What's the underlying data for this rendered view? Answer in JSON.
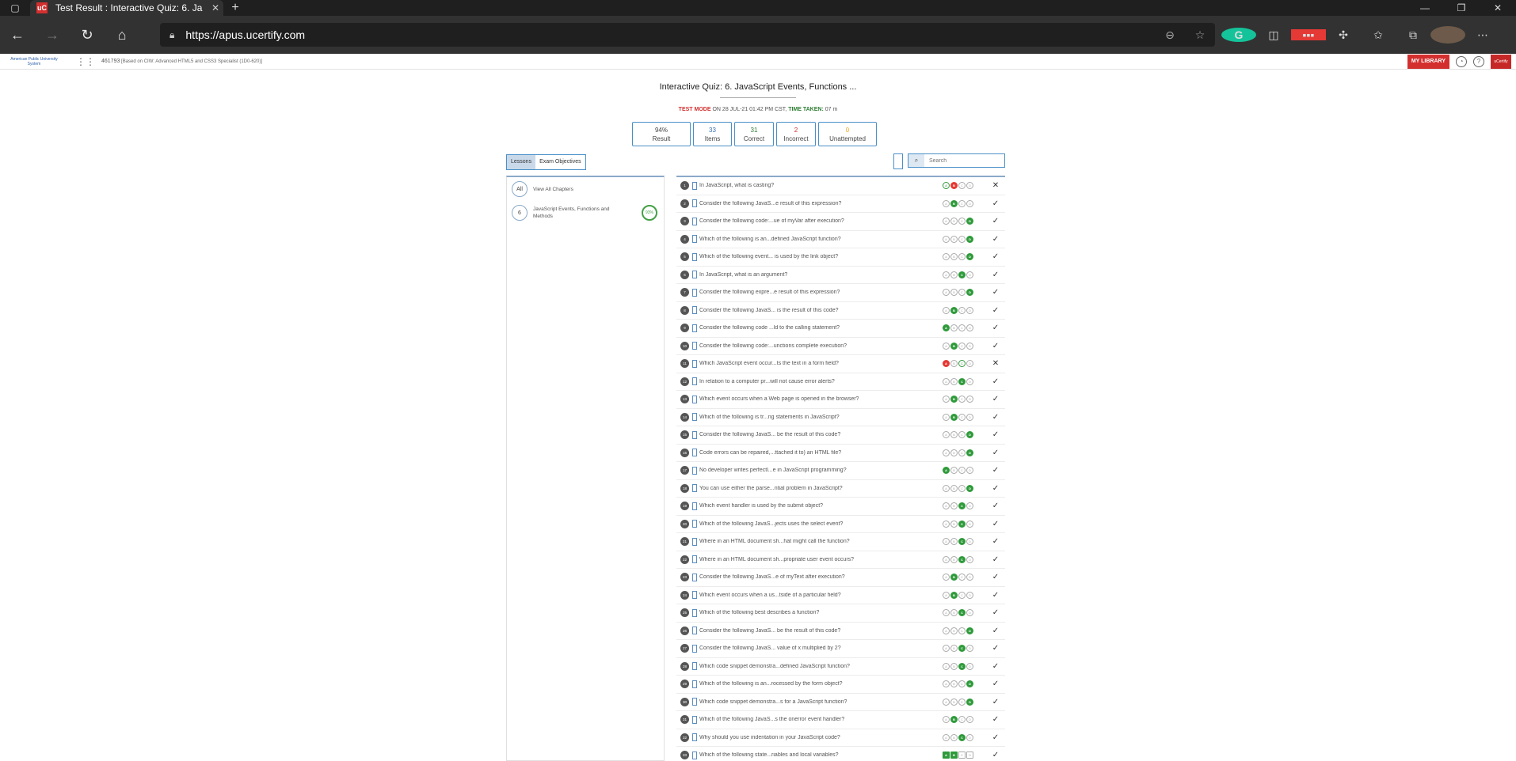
{
  "browser": {
    "tab_title": "Test Result : Interactive Quiz: 6. Ja",
    "url": "https://apus.ucertify.com",
    "new_tab": "+",
    "favicon_text": "uC"
  },
  "header": {
    "logo_text": "American Public University System",
    "course_id": "461793",
    "course_desc": "[Based on CIW: Advanced HTML5 and CSS3 Specialist (1D0-620)]",
    "my_library": "MY LIBRARY",
    "brand": "uCertify"
  },
  "quiz": {
    "title": "Interactive Quiz: 6. JavaScript Events, Functions ...",
    "mode_label": "TEST MODE",
    "on_label": "ON",
    "date": "28 JUL-21 01:42 PM CST,",
    "time_label": "TIME TAKEN:",
    "time_value": "07 m"
  },
  "stats": [
    {
      "value": "94%",
      "label": "Result",
      "color": "#333333"
    },
    {
      "value": "33",
      "label": "Items",
      "color": "#3a6fb0"
    },
    {
      "value": "31",
      "label": "Correct",
      "color": "#2e7d32"
    },
    {
      "value": "2",
      "label": "Incorrect",
      "color": "#d32f2f"
    },
    {
      "value": "0",
      "label": "Unattempted",
      "color": "#f5a623"
    }
  ],
  "tabs": {
    "lessons": "Lessons",
    "objectives": "Exam Objectives"
  },
  "search": {
    "placeholder": "Search"
  },
  "left_panel": {
    "all_label": "All",
    "all_text": "View All Chapters",
    "chapter_num": "6",
    "chapter_text": "JavaScript Events, Functions and Methods",
    "chapter_progress": "93%"
  },
  "questions": [
    {
      "n": "1",
      "text": "In JavaScript, what is casting?",
      "opts": [
        "g",
        "w",
        "",
        ""
      ],
      "mark": "✕"
    },
    {
      "n": "2",
      "text": "Consider the following JavaS...e result of this expression?",
      "opts": [
        "",
        "c",
        "",
        ""
      ],
      "mark": "✓"
    },
    {
      "n": "3",
      "text": "Consider the following code:...ue of myVar after execution?",
      "opts": [
        "",
        "",
        "",
        "c"
      ],
      "mark": "✓"
    },
    {
      "n": "4",
      "text": "Which of the following is an...defined JavaScript function?",
      "opts": [
        "",
        "",
        "",
        "c"
      ],
      "mark": "✓"
    },
    {
      "n": "5",
      "text": "Which of the following event... is used by the link object?",
      "opts": [
        "",
        "",
        "",
        "c"
      ],
      "mark": "✓"
    },
    {
      "n": "6",
      "text": "In JavaScript, what is an argument?",
      "opts": [
        "",
        "",
        "c",
        ""
      ],
      "mark": "✓"
    },
    {
      "n": "7",
      "text": "Consider the following expre...e result of this expression?",
      "opts": [
        "",
        "",
        "",
        "c"
      ],
      "mark": "✓"
    },
    {
      "n": "8",
      "text": "Consider the following JavaS... is the result of this code?",
      "opts": [
        "",
        "c",
        "",
        ""
      ],
      "mark": "✓"
    },
    {
      "n": "9",
      "text": "Consider the following code ...ld to the calling statement?",
      "opts": [
        "c",
        "",
        "",
        ""
      ],
      "mark": "✓"
    },
    {
      "n": "10",
      "text": "Consider the following code:...unctions complete execution?",
      "opts": [
        "",
        "c",
        "",
        ""
      ],
      "mark": "✓"
    },
    {
      "n": "11",
      "text": "Which JavaScript event occur...ts the text in a form field?",
      "opts": [
        "w",
        "",
        "g",
        ""
      ],
      "mark": "✕"
    },
    {
      "n": "12",
      "text": "In relation to a computer pr...will not cause error alerts?",
      "opts": [
        "",
        "",
        "c",
        ""
      ],
      "mark": "✓"
    },
    {
      "n": "13",
      "text": "Which event occurs when a Web page is opened in the browser?",
      "opts": [
        "",
        "c",
        "",
        ""
      ],
      "mark": "✓"
    },
    {
      "n": "14",
      "text": "Which of the following is tr...ng statements in JavaScript?",
      "opts": [
        "",
        "c",
        "",
        ""
      ],
      "mark": "✓"
    },
    {
      "n": "15",
      "text": "Consider the following JavaS... be the result of this code?",
      "opts": [
        "",
        "",
        "",
        "c"
      ],
      "mark": "✓"
    },
    {
      "n": "16",
      "text": "Code errors can be repaired,...ttached it to) an HTML file?",
      "opts": [
        "",
        "",
        "",
        "c"
      ],
      "mark": "✓"
    },
    {
      "n": "17",
      "text": "No developer writes perfectl...e in JavaScript programming?",
      "opts": [
        "c",
        "",
        "",
        ""
      ],
      "mark": "✓"
    },
    {
      "n": "18",
      "text": "You can use either the parse...ntial problem in JavaScript?",
      "opts": [
        "",
        "",
        "",
        "c"
      ],
      "mark": "✓"
    },
    {
      "n": "19",
      "text": "Which event handler is used by the submit object?",
      "opts": [
        "",
        "",
        "c",
        ""
      ],
      "mark": "✓"
    },
    {
      "n": "20",
      "text": "Which of the following JavaS...jects uses the select event?",
      "opts": [
        "",
        "",
        "c",
        ""
      ],
      "mark": "✓"
    },
    {
      "n": "21",
      "text": "Where in an HTML document sh...hat might call the function?",
      "opts": [
        "",
        "",
        "c",
        ""
      ],
      "mark": "✓"
    },
    {
      "n": "22",
      "text": "Where in an HTML document sh...propriate user event occurs?",
      "opts": [
        "",
        "",
        "c",
        ""
      ],
      "mark": "✓"
    },
    {
      "n": "23",
      "text": "Consider the following JavaS...e of myText after execution?",
      "opts": [
        "",
        "c",
        "",
        ""
      ],
      "mark": "✓"
    },
    {
      "n": "24",
      "text": "Which event occurs when a us...tside of a particular field?",
      "opts": [
        "",
        "c",
        "",
        ""
      ],
      "mark": "✓"
    },
    {
      "n": "25",
      "text": "Which of the following best describes a function?",
      "opts": [
        "",
        "",
        "c",
        ""
      ],
      "mark": "✓"
    },
    {
      "n": "26",
      "text": "Consider the following JavaS... be the result of this code?",
      "opts": [
        "",
        "",
        "",
        "c"
      ],
      "mark": "✓"
    },
    {
      "n": "27",
      "text": "Consider the following JavaS... value of x multiplied by 2?",
      "opts": [
        "",
        "",
        "c",
        ""
      ],
      "mark": "✓"
    },
    {
      "n": "28",
      "text": "Which code snippet demonstra...defined JavaScript function?",
      "opts": [
        "",
        "",
        "c",
        ""
      ],
      "mark": "✓"
    },
    {
      "n": "29",
      "text": "Which of the following is an...rocessed by the form object?",
      "opts": [
        "",
        "",
        "",
        "c"
      ],
      "mark": "✓"
    },
    {
      "n": "30",
      "text": "Which code snippet demonstra...s for a JavaScript function?",
      "opts": [
        "",
        "",
        "",
        "c"
      ],
      "mark": "✓"
    },
    {
      "n": "31",
      "text": "Which of the following JavaS...s the onerror event handler?",
      "opts": [
        "",
        "c",
        "",
        ""
      ],
      "mark": "✓"
    },
    {
      "n": "32",
      "text": "Why should you use indentation in your JavaScript code?",
      "opts": [
        "",
        "",
        "c",
        ""
      ],
      "mark": "✓"
    },
    {
      "n": "33",
      "text": "Which of the following state...riables and local variables?",
      "opts": [
        "c",
        "c",
        "",
        ""
      ],
      "mark": "✓",
      "square": true
    }
  ],
  "option_letters": [
    "A",
    "B",
    "C",
    "D"
  ],
  "colors": {
    "correct": "#2e9a3a",
    "incorrect": "#e53935",
    "accent": "#4a90c8"
  }
}
